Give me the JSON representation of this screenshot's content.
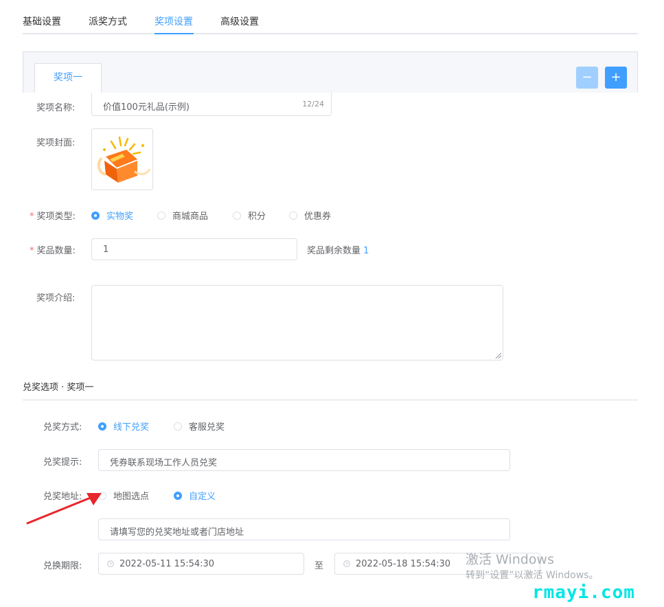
{
  "tabs": [
    {
      "label": "基础设置",
      "active": false
    },
    {
      "label": "派奖方式",
      "active": false
    },
    {
      "label": "奖项设置",
      "active": true
    },
    {
      "label": "高级设置",
      "active": false
    }
  ],
  "prize_tabs": [
    {
      "label": "奖项一",
      "active": true
    }
  ],
  "prize_buttons": {
    "minus": "−",
    "plus": "+"
  },
  "prize_form": {
    "name_label": "奖项名称:",
    "name_value": "价值100元礼品(示例)",
    "name_count": "12/24",
    "cover_label": "奖项封面:",
    "type_label": "奖项类型:",
    "type_options": [
      "实物奖",
      "商城商品",
      "积分",
      "优惠券"
    ],
    "type_selected": "实物奖",
    "quantity_label": "奖品数量:",
    "quantity_value": "1",
    "remaining_label": "奖品剩余数量",
    "remaining_value": "1",
    "intro_label": "奖项介绍:",
    "intro_value": ""
  },
  "redeem": {
    "section_title": "兑奖选项 · 奖项一",
    "method_label": "兑奖方式:",
    "method_options": [
      "线下兑奖",
      "客服兑奖"
    ],
    "method_selected": "线下兑奖",
    "hint_label": "兑奖提示:",
    "hint_value": "凭券联系现场工作人员兑奖",
    "address_label": "兑奖地址:",
    "address_options": [
      "地图选点",
      "自定义"
    ],
    "address_selected": "自定义",
    "address_value": "请填写您的兑奖地址或者门店地址",
    "period_label": "兑换期限:",
    "period_start": "2022-05-11 15:54:30",
    "period_sep": "至",
    "period_end": "2022-05-18 15:54:30"
  },
  "watermark": {
    "line1": "激活 Windows",
    "line2": "转到“设置”以激活 Windows。",
    "brand": "rmayi.com"
  },
  "colors": {
    "primary": "#409eff",
    "primary_light": "#a0cfff",
    "required": "#f56c6c",
    "annotation_arrow": "#e8262b"
  }
}
